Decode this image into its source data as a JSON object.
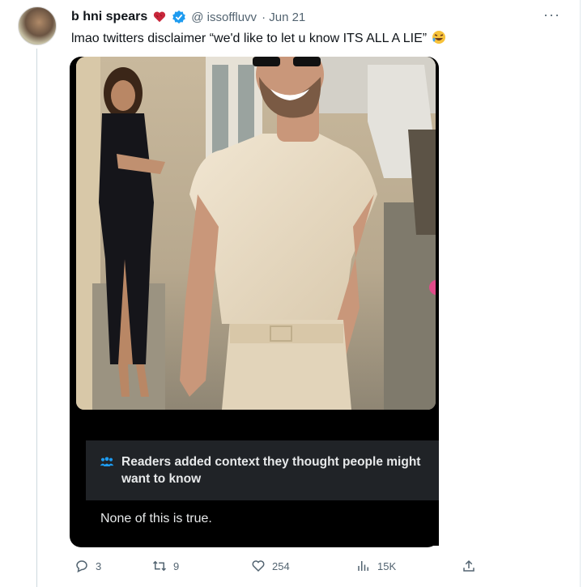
{
  "tweet": {
    "display_name": "b   hni spears",
    "handle": "@  issoffluvv",
    "date": "· Jun 21",
    "text": "lmao twitters disclaimer “we'd like to let u know ITS ALL A LIE”",
    "more": "···"
  },
  "community_note": {
    "title": "Readers added context they thought people might want to know",
    "body": "None of this is true."
  },
  "actions": {
    "replies": "3",
    "retweets": "9",
    "likes": "254",
    "views": "15K"
  },
  "icons": [
    "heart-emoji-icon",
    "verified-icon",
    "laughing-emoji-icon",
    "people-icon",
    "reply-icon",
    "retweet-icon",
    "like-icon",
    "views-icon",
    "share-icon"
  ],
  "colors": {
    "verified": "#1d9bf0",
    "muted": "#536471",
    "note_bg": "#202327"
  }
}
